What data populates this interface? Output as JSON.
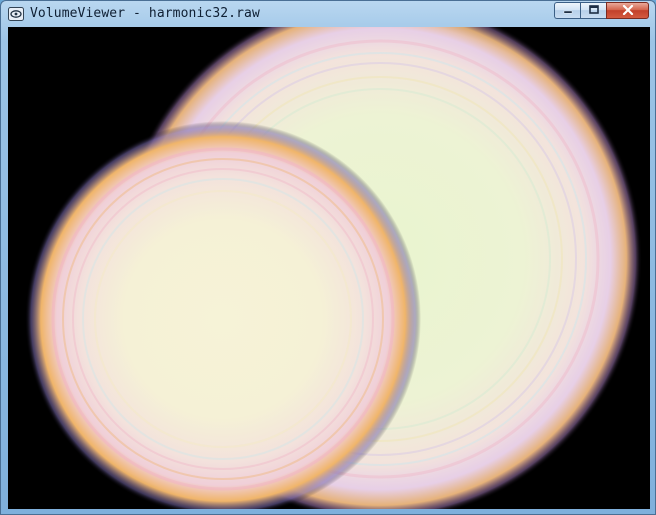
{
  "window": {
    "title": "VolumeViewer - harmonic32.raw",
    "app_icon": "volume-viewer-app-icon",
    "controls": {
      "minimize_icon": "minimize-icon",
      "maximize_icon": "maximize-icon",
      "close_icon": "close-icon"
    }
  },
  "viewport": {
    "content": "volume-rendering",
    "background_color": "#000000",
    "colors": {
      "core_large": "#eef6d2",
      "core_small": "#f7f3d8",
      "ring_orange": "#f0a850",
      "ring_pink": "#f2b0c4",
      "ring_lavender": "#c8b6ea",
      "ring_cyan": "#bfe8f0"
    }
  }
}
